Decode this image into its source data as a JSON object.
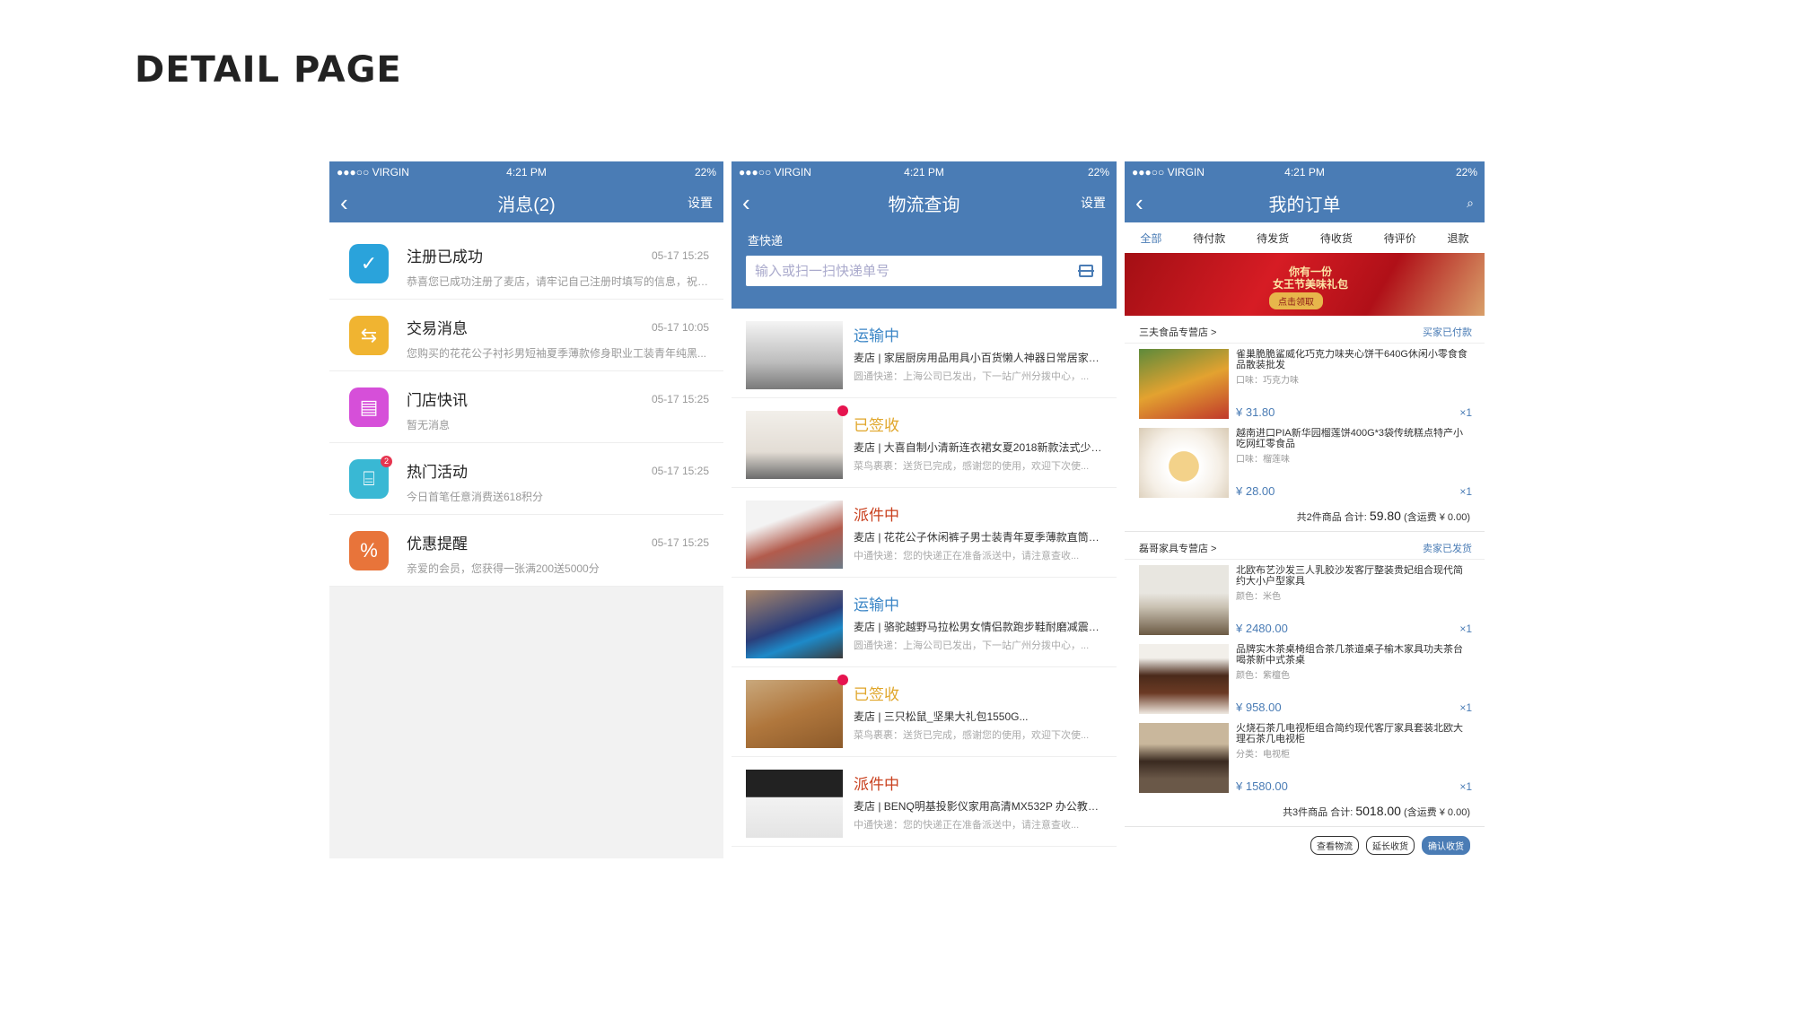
{
  "page_title": "DETAIL PAGE",
  "status": {
    "carrier": "●●●○○ VIRGIN",
    "time": "4:21 PM",
    "battery": "22%"
  },
  "messages": {
    "title": "消息(2)",
    "settings": "设置",
    "items": [
      {
        "name": "注册已成功",
        "time": "05-17  15:25",
        "sub": "恭喜您已成功注册了麦店，请牢记自己注册时填写的信息，祝您...",
        "color": "#2aa3db",
        "icon": "check-icon",
        "glyph": "✓"
      },
      {
        "name": "交易消息",
        "time": "05-17 10:05",
        "sub": "您购买的花花公子衬衫男短袖夏季薄款修身职业工装青年纯黑...",
        "color": "#f0b431",
        "icon": "transaction-icon",
        "glyph": "⇆"
      },
      {
        "name": "门店快讯",
        "time": "05-17  15:25",
        "sub": "暂无消息",
        "color": "#d64fd9",
        "icon": "store-icon",
        "glyph": "▤"
      },
      {
        "name": "热门活动",
        "time": "05-17  15:25",
        "sub": "今日首笔任意消费送618积分",
        "color": "#39b8d4",
        "icon": "gift-icon",
        "glyph": "⌸",
        "badge": "2"
      },
      {
        "name": "优惠提醒",
        "time": "05-17  15:25",
        "sub": "亲爱的会员，您获得一张满200送5000分",
        "color": "#e8743a",
        "icon": "coupon-icon",
        "glyph": "%"
      }
    ]
  },
  "logistics": {
    "title": "物流查询",
    "settings": "设置",
    "search_label": "查快递",
    "search_placeholder": "输入或扫一扫快递单号",
    "items": [
      {
        "status": "运输中",
        "status_color": "#3b86c6",
        "name": "麦店 | 家居厨房用品用具小百货懒人神器日常居家生...",
        "detail": "圆通快递：上海公司已发出，下一站广州分拨中心，...",
        "dot": false,
        "bg": "linear-gradient(180deg,#f4f4f4,#bdbdbd 60%,#7a7a7a)"
      },
      {
        "status": "已签收",
        "status_color": "#e0a62a",
        "name": "麦店 | 大喜自制小清新连衣裙女夏2018新款法式少女...",
        "detail": "菜鸟裹裹：送货已完成，感谢您的使用，欢迎下次使...",
        "dot": true,
        "bg": "linear-gradient(180deg,#f2efea,#e3ddd5 60%,#6b6b6b)"
      },
      {
        "status": "派件中",
        "status_color": "#c9401e",
        "name": "麦店 | 花花公子休闲裤子男士装青年夏季薄款直筒弹...",
        "detail": "中通快递：您的快递正在准备派送中，请注意查收...",
        "dot": false,
        "bg": "linear-gradient(160deg,#f3f3f3 30%,#b25b4c 60%,#6d7a86)"
      },
      {
        "status": "运输中",
        "status_color": "#3b86c6",
        "name": "麦店 | 骆驼越野马拉松男女情侣款跑步鞋耐磨减震防...",
        "detail": "圆通快递：上海公司已发出，下一站广州分拨中心，...",
        "dot": false,
        "bg": "linear-gradient(160deg,#a9866a,#2b3e7a 50%,#1d8ac9 70%,#3a3a3a)"
      },
      {
        "status": "已签收",
        "status_color": "#e0a62a",
        "name": "麦店 | 三只松鼠_坚果大礼包1550G...",
        "detail": "菜鸟裹裹：送货已完成，感谢您的使用，欢迎下次使...",
        "dot": true,
        "bg": "linear-gradient(160deg,#c9a87c,#b0773d 50%,#8c5a2a)"
      },
      {
        "status": "派件中",
        "status_color": "#c9401e",
        "name": "麦店 | BENQ明基投影仪家用高清MX532P 办公教学...",
        "detail": "中通快递：您的快递正在准备派送中，请注意查收...",
        "dot": false,
        "bg": "linear-gradient(180deg,#222 40%,#f2f2f2 41%,#e4e4e4)"
      }
    ]
  },
  "orders": {
    "title": "我的订单",
    "tabs": [
      "全部",
      "待付款",
      "待发货",
      "待收货",
      "待评价",
      "退款"
    ],
    "banner_title": "你有一份\n女王节美味礼包",
    "banner_button": "点击领取",
    "shops": [
      {
        "name": "三夫食品专营店 >",
        "state": "买家已付款",
        "items": [
          {
            "name": "雀巢脆脆鲨威化巧克力味夹心饼干640G休闲小零食食品散装批发",
            "variant": "口味：巧克力味",
            "price": "¥ 31.80",
            "qty": "×1",
            "bg": "linear-gradient(160deg,#5d8a3b,#e3a230 50%,#c0392b)"
          },
          {
            "name": "越南进口PIA新华园榴莲饼400G*3袋传统糕点特产小吃网红零食品",
            "variant": "口味：榴莲味",
            "price": "¥ 28.00",
            "qty": "×1",
            "bg": "radial-gradient(circle at 50% 55%,#f3d28a 25%,#fff 26%,#f5efe6 60%,#d9cbb5)"
          }
        ],
        "summary_pre": "共2件商品  合计: ",
        "total": "59.80",
        "summary_post": " (含运费 ¥ 0.00)"
      },
      {
        "name": "磊哥家具专营店 >",
        "state": "卖家已发货",
        "items": [
          {
            "name": "北欧布艺沙发三人乳胶沙发客厅整装贵妃组合现代简约大小户型家具",
            "variant": "颜色：米色",
            "price": "¥ 2480.00",
            "qty": "×1",
            "bg": "linear-gradient(180deg,#e8e6e0 40%,#c9c1b2 60%,#6b5a44)"
          },
          {
            "name": "品牌实木茶桌椅组合茶几茶道桌子榆木家具功夫茶台喝茶新中式茶桌",
            "variant": "颜色：紫檀色",
            "price": "¥ 958.00",
            "qty": "×1",
            "bg": "linear-gradient(180deg,#f2efea 20%,#4a2a1a 45%,#6b3a24 70%,#efe9e1)"
          },
          {
            "name": "火烧石茶几电视柜组合简约现代客厅家具套装北欧大理石茶几电视柜",
            "variant": "分类：电视柜",
            "price": "¥ 1580.00",
            "qty": "×1",
            "bg": "linear-gradient(180deg,#c9b79c 30%,#3a2a20 55%,#6a5848 80%)"
          }
        ],
        "summary_pre": "共3件商品  合计: ",
        "total": "5018.00",
        "summary_post": " (含运费 ¥ 0.00)"
      }
    ],
    "actions": [
      "查看物流",
      "延长收货",
      "确认收货"
    ]
  }
}
